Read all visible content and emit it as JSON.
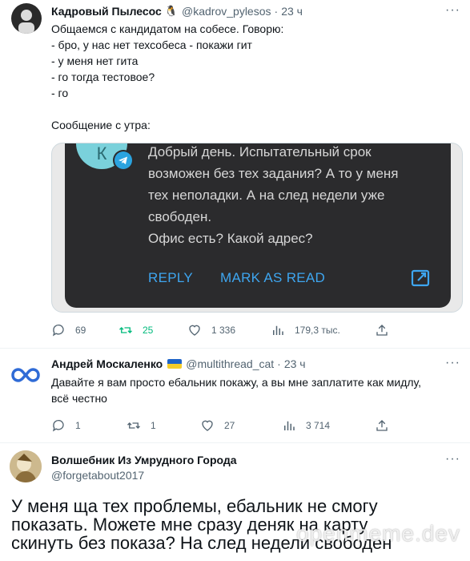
{
  "tweets": [
    {
      "name": "Кадровый Пылесос",
      "handle": "@kadrov_pylesos",
      "time": "23 ч",
      "text": "Общаемся с кандидатом на собесе. Говорю:\n- бро, у нас нет техсобеса - покажи гит\n- у меня нет гита\n- го тогда тестовое?\n- го\n\nСообщение с утра:",
      "embedded": {
        "avatar_letter": "К",
        "message": "Добрый день. Испытательный срок\nвозможен без тех задания? А то у меня\nтех неполадки. А на след недели уже\nсвободен.\nОфис есть? Какой адрес?",
        "reply_label": "REPLY",
        "mark_read_label": "MARK AS READ"
      },
      "actions": {
        "replies": "69",
        "retweets": "25",
        "likes": "1 336",
        "views": "179,3 тыс."
      }
    },
    {
      "name": "Андрей Москаленко",
      "handle": "@multithread_cat",
      "time": "23 ч",
      "text": "Давайте я вам просто ебальник покажу, а вы мне заплатите как мидлу,\nвсё честно",
      "actions": {
        "replies": "1",
        "retweets": "1",
        "likes": "27",
        "views": "3 714"
      }
    },
    {
      "name": "Волшебник Из Умрудного Города",
      "handle": "@forgetabout2017",
      "text": "У меня ща тех проблемы, ебальник не смогу\nпоказать. Можете мне сразу деняк на карту\nскинуть без показа? На след недели свободен"
    }
  ],
  "watermark": "openmeme.dev",
  "colors": {
    "accent": "#1d9bf0",
    "retweet_active": "#00ba7c",
    "muted": "#536471"
  }
}
